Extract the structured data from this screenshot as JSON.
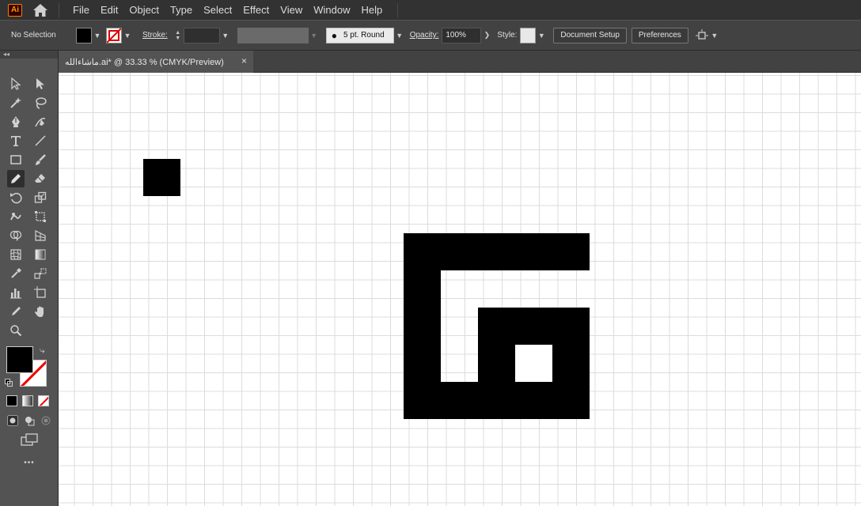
{
  "app": {
    "logo_text": "Ai"
  },
  "menu": [
    "File",
    "Edit",
    "Object",
    "Type",
    "Select",
    "Effect",
    "View",
    "Window",
    "Help"
  ],
  "control_bar": {
    "selection_label": "No Selection",
    "stroke_label": "Stroke:",
    "brush_value": "5 pt. Round",
    "opacity_label": "Opacity:",
    "opacity_value": "100%",
    "style_label": "Style:",
    "document_setup": "Document Setup",
    "preferences": "Preferences"
  },
  "document_tab": {
    "title": "ماشاءالله.ai* @ 33.33 % (CMYK/Preview)",
    "close": "×"
  },
  "toolbar": {
    "collapse": "◂◂",
    "more": "•••"
  },
  "colors": {
    "accent": "#ff9a00",
    "fill": "#000000",
    "stroke": "none"
  }
}
